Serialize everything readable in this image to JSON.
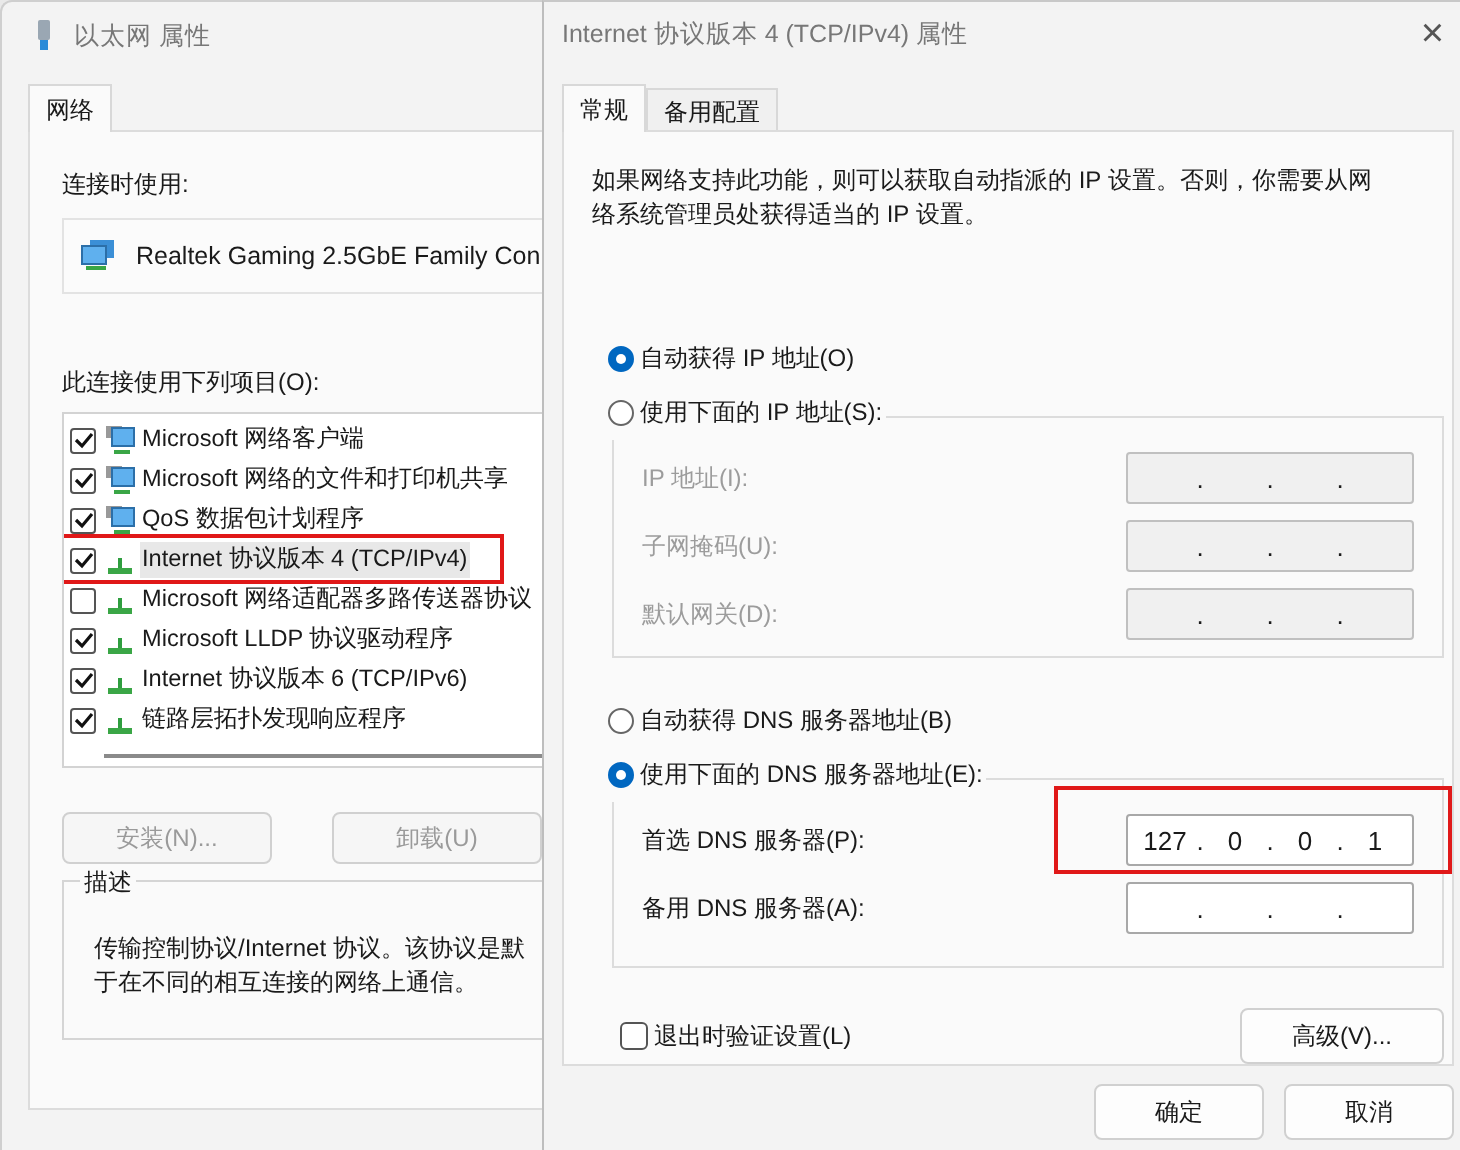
{
  "left_window": {
    "title": "以太网 属性",
    "tabs": [
      {
        "label": "网络",
        "selected": true
      }
    ],
    "connect_using_label": "连接时使用:",
    "adapter": "Realtek Gaming 2.5GbE Family Con",
    "items_label": "此连接使用下列项目(O):",
    "items": [
      {
        "label": "Microsoft 网络客户端",
        "checked": true,
        "selected": false,
        "kind": "client"
      },
      {
        "label": "Microsoft 网络的文件和打印机共享",
        "checked": true,
        "selected": false,
        "kind": "client"
      },
      {
        "label": "QoS 数据包计划程序",
        "checked": true,
        "selected": false,
        "kind": "client"
      },
      {
        "label": "Internet 协议版本 4 (TCP/IPv4)",
        "checked": true,
        "selected": true,
        "kind": "protocol",
        "highlighted": true
      },
      {
        "label": "Microsoft 网络适配器多路传送器协议",
        "checked": false,
        "selected": false,
        "kind": "protocol"
      },
      {
        "label": "Microsoft LLDP 协议驱动程序",
        "checked": true,
        "selected": false,
        "kind": "protocol"
      },
      {
        "label": "Internet 协议版本 6 (TCP/IPv6)",
        "checked": true,
        "selected": false,
        "kind": "protocol"
      },
      {
        "label": "链路层拓扑发现响应程序",
        "checked": true,
        "selected": false,
        "kind": "protocol"
      }
    ],
    "buttons": [
      {
        "label": "安装(N)...",
        "disabled": true
      },
      {
        "label": "卸载(U)",
        "disabled": true
      }
    ],
    "description": {
      "title": "描述",
      "line1": "传输控制协议/Internet 协议。该协议是默",
      "line2": "于在不同的相互连接的网络上通信。"
    }
  },
  "right_window": {
    "title": "Internet 协议版本 4 (TCP/IPv4) 属性",
    "close": "×",
    "tabs": [
      {
        "label": "常规",
        "selected": true
      },
      {
        "label": "备用配置",
        "selected": false
      }
    ],
    "intro": "如果网络支持此功能，则可以获取自动指派的 IP 设置。否则，你需要从网络系统管理员处获得适当的 IP 设置。",
    "ip_radios": [
      {
        "label": "自动获得 IP 地址(O)",
        "selected": true
      },
      {
        "label": "使用下面的 IP 地址(S):",
        "selected": false
      }
    ],
    "ip_fields": [
      {
        "label": "IP 地址(I):",
        "disabled": true,
        "separator": "."
      },
      {
        "label": "子网掩码(U):",
        "disabled": true,
        "separator": "."
      },
      {
        "label": "默认网关(D):",
        "disabled": true,
        "separator": "."
      }
    ],
    "dns_radios": [
      {
        "label": "自动获得 DNS 服务器地址(B)",
        "selected": false
      },
      {
        "label": "使用下面的 DNS 服务器地址(E):",
        "selected": true
      }
    ],
    "dns_fields": [
      {
        "label": "首选 DNS 服务器(P):",
        "disabled": false,
        "separator": ".",
        "octets": [
          "127",
          "0",
          "0",
          "1"
        ],
        "highlighted": true
      },
      {
        "label": "备用 DNS 服务器(A):",
        "disabled": false,
        "separator": "."
      }
    ],
    "validate": {
      "label": "退出时验证设置(L)",
      "checked": false
    },
    "advanced_button": "高级(V)...",
    "buttons": [
      "确定",
      "取消"
    ]
  }
}
